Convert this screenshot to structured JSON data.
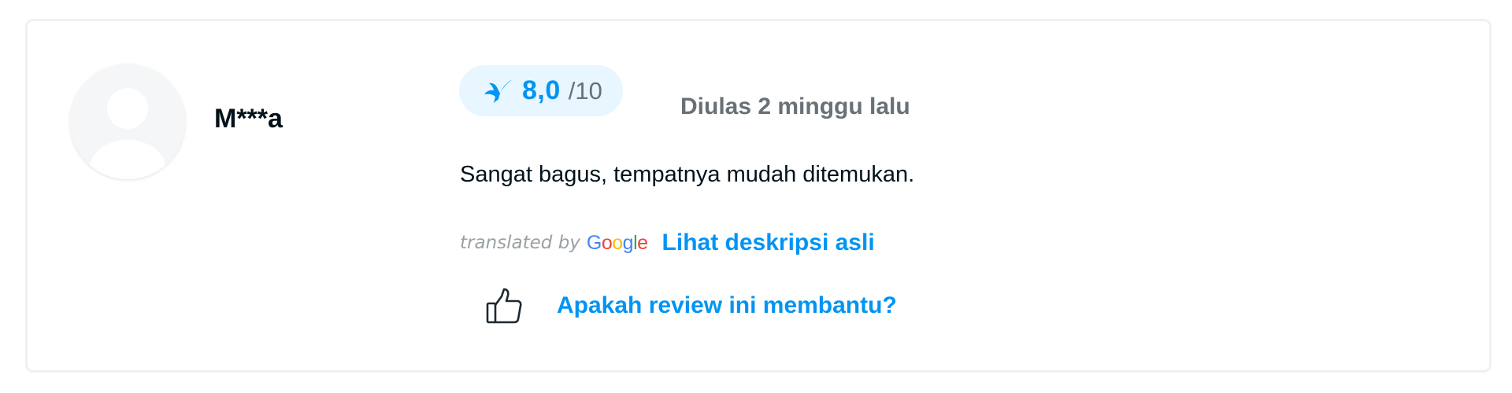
{
  "review": {
    "reviewer_name": "M***a",
    "score": {
      "value": "8,0",
      "max": "/10",
      "icon": "traveloka-bird-icon"
    },
    "date_label": "Diulas 2 minggu lalu",
    "text": "Sangat bagus, tempatnya mudah ditemukan.",
    "translation": {
      "translated_by": "translated by",
      "provider": "Google",
      "see_original_label": "Lihat deskripsi asli"
    },
    "helpful": {
      "icon": "thumbs-up-icon",
      "label": "Apakah review ini membantu?"
    }
  },
  "colors": {
    "accent": "#0194f3",
    "score_bg": "#e7f6ff",
    "muted_text": "#687176",
    "body_text": "#03121a",
    "card_border": "#eef0f2"
  }
}
